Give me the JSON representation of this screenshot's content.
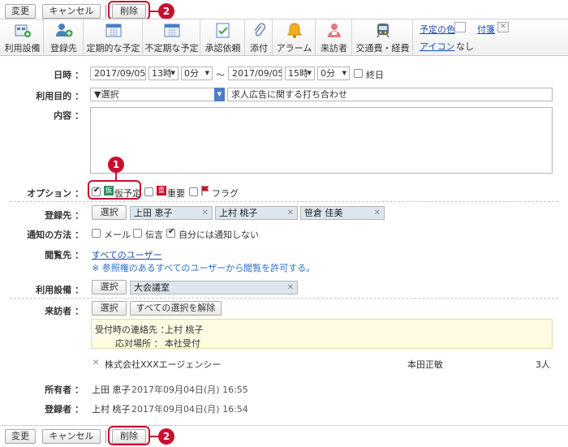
{
  "top_actions": {
    "change": "変更",
    "cancel": "キャンセル",
    "delete": "削除",
    "callout": "2"
  },
  "toolbar": {
    "items": [
      {
        "label": "利用設備",
        "icon": "facility-icon"
      },
      {
        "label": "登録先",
        "icon": "user-add-icon"
      },
      {
        "label": "定期的な予定",
        "icon": "calendar-icon"
      },
      {
        "label": "不定期な予定",
        "icon": "calendar-icon"
      },
      {
        "label": "承認依頼",
        "icon": "approval-icon"
      },
      {
        "label": "添付",
        "icon": "paperclip-icon"
      },
      {
        "label": "アラーム",
        "icon": "bell-icon"
      },
      {
        "label": "来訪者",
        "icon": "visitor-icon"
      },
      {
        "label": "交通費・経費",
        "icon": "train-icon"
      }
    ],
    "color_link": "予定の色",
    "tag_link": "付箋",
    "icon_link": "アイコン",
    "icon_value": "なし"
  },
  "form": {
    "datetime": {
      "label": "日時 ：",
      "start_date": "2017/09/05",
      "start_hour": "13時",
      "start_min": "0分",
      "separator": "～",
      "end_date": "2017/09/05",
      "end_hour": "15時",
      "end_min": "0分",
      "allday": "終日"
    },
    "purpose": {
      "label": "利用目的 ：",
      "select": "▼選択",
      "value": "求人広告に関する打ち合わせ"
    },
    "content": {
      "label": "内容 ："
    },
    "options": {
      "label": "オプション ：",
      "tentative_badge": "仮",
      "tentative": "仮予定",
      "important_badge": "重",
      "important": "重要",
      "flag": "フラグ",
      "callout": "1"
    },
    "registrants": {
      "label": "登録先 ：",
      "select": "選択",
      "users": [
        "上田 恵子",
        "上村 桃子",
        "笹倉 佳美"
      ]
    },
    "notify": {
      "label": "通知の方法 ：",
      "mail": "メール",
      "message": "伝言",
      "no_self": "自分には通知しない"
    },
    "viewers": {
      "label": "閲覧先 ：",
      "link": "すべてのユーザー",
      "note": "※ 参照権のあるすべてのユーザーから閲覧を許可する。"
    },
    "facility": {
      "label": "利用設備 ：",
      "select": "選択",
      "value": "大会議室"
    },
    "visitors": {
      "label": "来訪者 ：",
      "select": "選択",
      "clear": "すべての選択を解除",
      "contact_label": "受付時の連絡先 ：",
      "contact_value": "上村 桃子",
      "place_label": "応対場所 ：",
      "place_value": "本社受付",
      "company": "株式会社XXXエージェンシー",
      "person": "本田正敏",
      "count": "3人"
    },
    "owner": {
      "label": "所有者 ：",
      "name": "上田 恵子",
      "date": "2017年09月04日(月) 16:55"
    },
    "registrar": {
      "label": "登録者 ：",
      "name": "上村 桃子",
      "date": "2017年09月04日(月) 16:54"
    }
  },
  "bottom_actions": {
    "change": "変更",
    "cancel": "キャンセル",
    "delete": "削除",
    "callout": "2"
  }
}
